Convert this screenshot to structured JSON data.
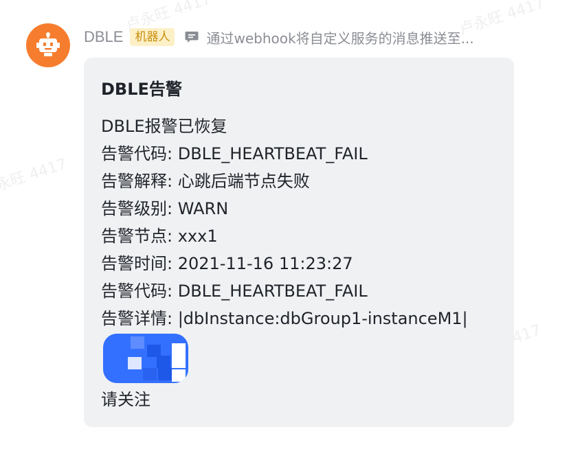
{
  "message": {
    "sender": "DBLE",
    "badge": "机器人",
    "preview": "通过webhook将自定义服务的消息推送至...",
    "avatar_icon": "robot-icon",
    "preview_icon": "message-icon"
  },
  "card": {
    "title": "DBLE告警",
    "lines": [
      "DBLE报警已恢复",
      "告警代码: DBLE_HEARTBEAT_FAIL",
      "告警解释: 心跳后端节点失败",
      "告警级别: WARN",
      "告警节点: xxx1",
      "告警时间: 2021-11-16 11:23:27",
      "告警代码: DBLE_HEARTBEAT_FAIL",
      "告警详情: |dbInstance:dbGroup1-instanceM1|"
    ],
    "footer": "请关注"
  },
  "watermark": "卢永旺 4417",
  "colors": {
    "avatar_bg": "#f77d2e",
    "badge_bg": "#fdf0c7",
    "badge_text": "#c98e0a",
    "card_bg": "#f0f1f3",
    "mention_bg": "#3370ff"
  }
}
